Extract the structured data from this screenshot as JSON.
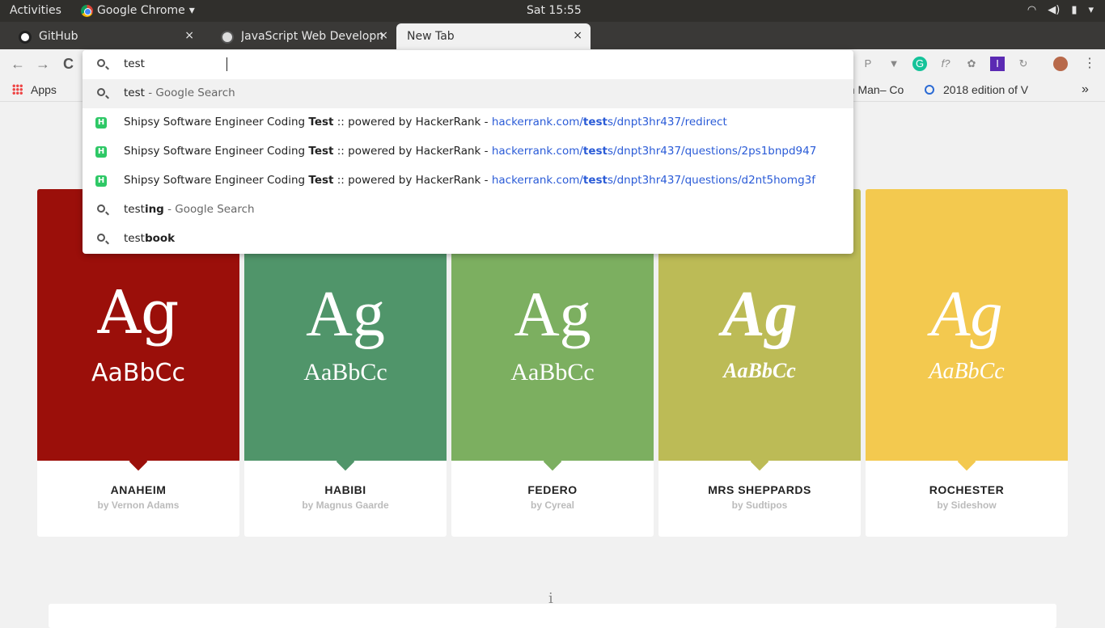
{
  "system": {
    "activities": "Activities",
    "app": "Google Chrome",
    "app_caret": "▾",
    "clock": "Sat 15:55",
    "wifi": "wifi-icon",
    "volume": "volume-icon",
    "battery": "battery-icon",
    "power": "▾"
  },
  "tabs": [
    {
      "label": "GitHub",
      "close": "×"
    },
    {
      "label": "JavaScript Web Developm",
      "close": "×"
    },
    {
      "label": "New Tab",
      "close": "×"
    }
  ],
  "new_tab": "+",
  "toolbar": {
    "back": "←",
    "forward": "→",
    "reload": "C"
  },
  "omnibox": {
    "value": "test",
    "rows": [
      {
        "pre": "test",
        "mid": "",
        "post": " - Google Search",
        "type": "search"
      },
      {
        "title_a": "Shipsy Software Engineer Coding ",
        "title_b": "Test",
        "title_c": " :: powered by HackerRank - ",
        "url_a": "hackerrank.com/",
        "url_b": "test",
        "url_c": "s/dnpt3hr437/redirect",
        "type": "site"
      },
      {
        "title_a": "Shipsy Software Engineer Coding ",
        "title_b": "Test",
        "title_c": " :: powered by HackerRank - ",
        "url_a": "hackerrank.com/",
        "url_b": "test",
        "url_c": "s/dnpt3hr437/questions/2ps1bnpd947",
        "type": "site"
      },
      {
        "title_a": "Shipsy Software Engineer Coding ",
        "title_b": "Test",
        "title_c": " :: powered by HackerRank - ",
        "url_a": "hackerrank.com/",
        "url_b": "test",
        "url_c": "s/dnpt3hr437/questions/d2nt5homg3f",
        "type": "site"
      },
      {
        "pre": "test",
        "mid": "ing",
        "post": " - Google Search",
        "type": "search"
      },
      {
        "pre": "test",
        "mid": "book",
        "post": "",
        "type": "search"
      }
    ]
  },
  "bookmarks": {
    "apps": "Apps",
    "item_partial": "an Man– Co",
    "item2": "2018 edition of V",
    "more": "»"
  },
  "extensions": [
    "P",
    "▼",
    "G",
    "f?",
    "✿",
    "I",
    "↻"
  ],
  "fonts": [
    {
      "ag": "Ag",
      "sample": "AaBbCc",
      "name": "ANAHEIM",
      "by": "by Vernon Adams",
      "color": "#9b0f0a"
    },
    {
      "ag": "Ag",
      "sample": "AaBbCc",
      "name": "HABIBI",
      "by": "by Magnus Gaarde",
      "color": "#50956a"
    },
    {
      "ag": "Ag",
      "sample": "AaBbCc",
      "name": "FEDERO",
      "by": "by Cyreal",
      "color": "#7caf60"
    },
    {
      "ag": "Ag",
      "sample": "AaBbCc",
      "name": "MRS SHEPPARDS",
      "by": "by Sudtipos",
      "color": "#bcbb56"
    },
    {
      "ag": "Ag",
      "sample": "AaBbCc",
      "name": "ROCHESTER",
      "by": "by Sideshow",
      "color": "#f3c94f"
    }
  ],
  "info_glyph": "i"
}
